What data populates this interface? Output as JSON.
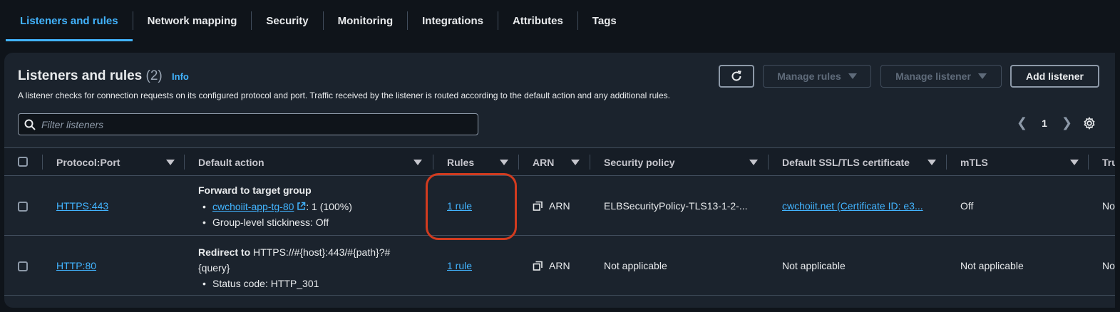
{
  "tabs": [
    {
      "label": "Listeners and rules",
      "active": true
    },
    {
      "label": "Network mapping"
    },
    {
      "label": "Security"
    },
    {
      "label": "Monitoring"
    },
    {
      "label": "Integrations"
    },
    {
      "label": "Attributes"
    },
    {
      "label": "Tags"
    }
  ],
  "panel": {
    "title": "Listeners and rules",
    "count": "(2)",
    "info": "Info",
    "description": "A listener checks for connection requests on its configured protocol and port. Traffic received by the listener is routed according to the default action and any additional rules.",
    "buttons": {
      "manage_rules": "Manage rules",
      "manage_listener": "Manage listener",
      "add_listener": "Add listener"
    },
    "filter_placeholder": "Filter listeners",
    "page": "1"
  },
  "table": {
    "headers": {
      "protocol_port": "Protocol:Port",
      "default_action": "Default action",
      "rules": "Rules",
      "arn": "ARN",
      "security_policy": "Security policy",
      "certificate": "Default SSL/TLS certificate",
      "mtls": "mTLS",
      "trust": "Tru"
    },
    "rows": [
      {
        "protocol_port": "HTTPS:443",
        "action_title": "Forward to target group",
        "target_group": "cwchoiit-app-tg-80",
        "target_weight": ": 1 (100%)",
        "stickiness": "Group-level stickiness: Off",
        "rules": "1 rule",
        "arn": "ARN",
        "security_policy": "ELBSecurityPolicy-TLS13-1-2-...",
        "certificate": "cwchoiit.net (Certificate ID: e3...",
        "mtls": "Off",
        "trust": "No"
      },
      {
        "protocol_port": "HTTP:80",
        "action_prefix": "Redirect to",
        "action_target_1": "HTTPS://#{host}:443/#{path}?#",
        "action_target_2": "{query}",
        "status_code": "Status code: HTTP_301",
        "rules": "1 rule",
        "arn": "ARN",
        "security_policy": "Not applicable",
        "certificate": "Not applicable",
        "mtls": "Not applicable",
        "trust": "No"
      }
    ]
  },
  "colors": {
    "accent": "#42b4ff",
    "highlight": "#d23b1f",
    "background": "#0f141a",
    "panel": "#1b232d"
  }
}
